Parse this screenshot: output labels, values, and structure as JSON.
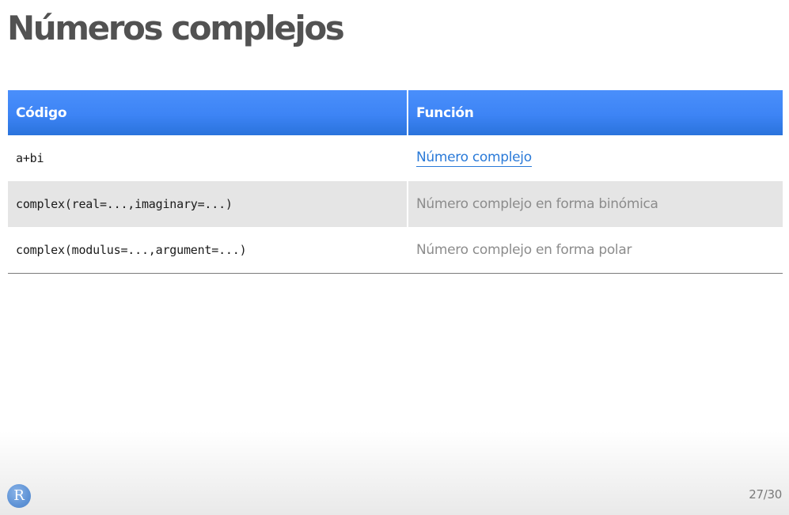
{
  "slide": {
    "title": "Números complejos",
    "page_number": "27/30",
    "logo_letter": "R"
  },
  "table": {
    "headers": [
      "Código",
      "Función"
    ],
    "rows": [
      {
        "code": "a+bi",
        "function": "Número complejo",
        "function_is_link": true
      },
      {
        "code": "complex(real=...,imaginary=...)",
        "function": "Número complejo en forma binómica",
        "function_is_link": false
      },
      {
        "code": "complex(modulus=...,argument=...)",
        "function": "Número complejo en forma polar",
        "function_is_link": false
      }
    ]
  },
  "colors": {
    "header_blue": "#3d84f5",
    "link_blue": "#2a7ad8",
    "title_gray": "#525252",
    "alt_row_gray": "#e5e5e5"
  },
  "icons": {
    "logo": "r-logo-icon"
  }
}
